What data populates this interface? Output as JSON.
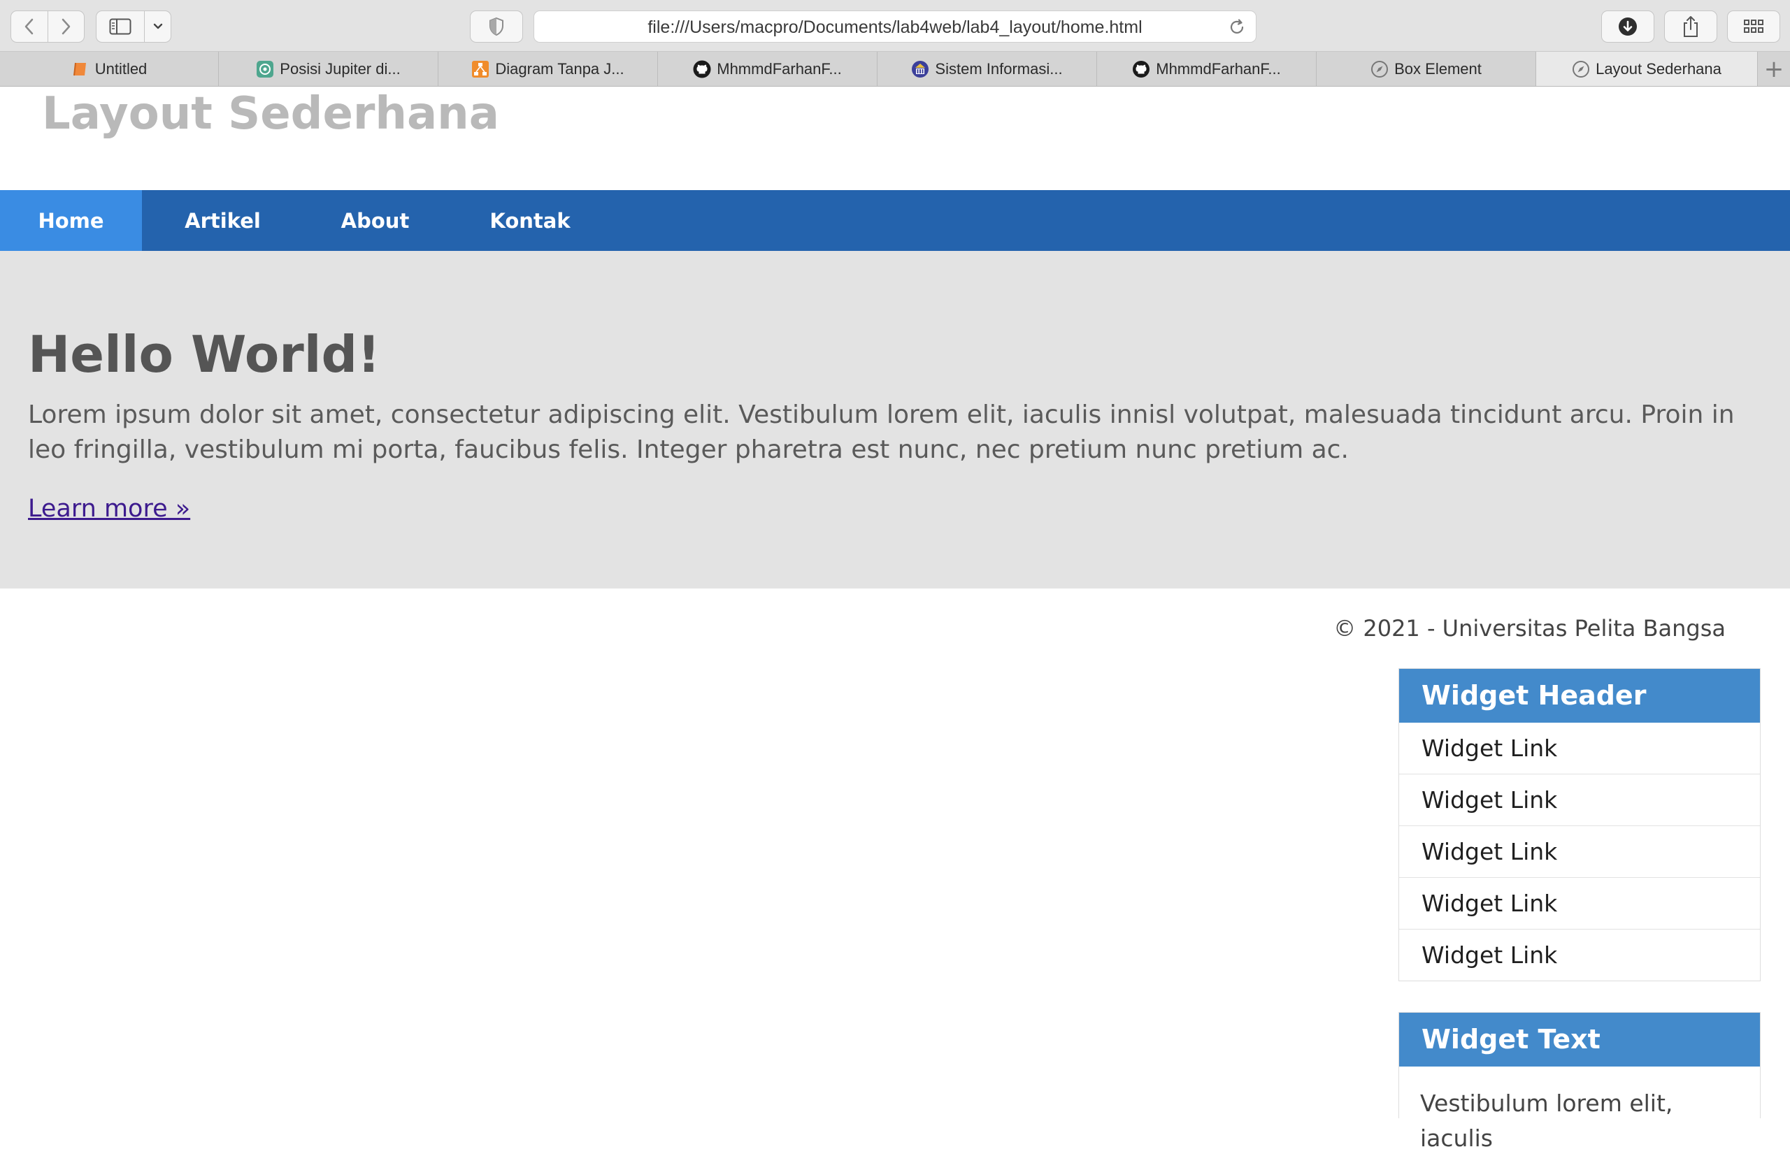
{
  "browser": {
    "url": "file:///Users/macpro/Documents/lab4web/lab4_layout/home.html",
    "tabs": [
      {
        "label": "Untitled",
        "icon": "book-icon",
        "color": "#f0883a"
      },
      {
        "label": "Posisi Jupiter di...",
        "icon": "openai-icon",
        "color": "#4ea68e"
      },
      {
        "label": "Diagram Tanpa J...",
        "icon": "drawio-icon",
        "color": "#f08c2b"
      },
      {
        "label": "MhmmdFarhanF...",
        "icon": "github-icon",
        "color": "#1b1b1b"
      },
      {
        "label": "Sistem Informasi...",
        "icon": "university-icon",
        "color": "#3b3f9a"
      },
      {
        "label": "MhmmdFarhanF...",
        "icon": "github-icon",
        "color": "#1b1b1b"
      },
      {
        "label": "Box Element",
        "icon": "compass-icon",
        "color": "#777777"
      },
      {
        "label": "Layout Sederhana",
        "icon": "compass-icon",
        "color": "#777777"
      }
    ],
    "active_tab": 7
  },
  "page": {
    "title": "Layout Sederhana",
    "nav": [
      {
        "label": "Home",
        "active": true
      },
      {
        "label": "Artikel",
        "active": false
      },
      {
        "label": "About",
        "active": false
      },
      {
        "label": "Kontak",
        "active": false
      }
    ],
    "hero": {
      "heading": "Hello World!",
      "body": "Lorem ipsum dolor sit amet, consectetur adipiscing elit. Vestibulum lorem elit, iaculis innisl volutpat, malesuada tincidunt arcu. Proin in leo fringilla, vestibulum mi porta, faucibus felis. Integer pharetra est nunc, nec pretium nunc pretium ac.",
      "link": "Learn more »"
    },
    "footer": "© 2021 - Universitas Pelita Bangsa",
    "widget_links": {
      "header": "Widget Header",
      "links": [
        "Widget Link",
        "Widget Link",
        "Widget Link",
        "Widget Link",
        "Widget Link"
      ]
    },
    "widget_text": {
      "header": "Widget Text",
      "body": "Vestibulum lorem elit, iaculis"
    }
  },
  "colors": {
    "nav_bg": "#2463ad",
    "nav_active": "#3a8ce3",
    "widget_header": "#438acb",
    "hero_bg": "#e3e3e3",
    "link_visited": "#3d1b8e"
  }
}
